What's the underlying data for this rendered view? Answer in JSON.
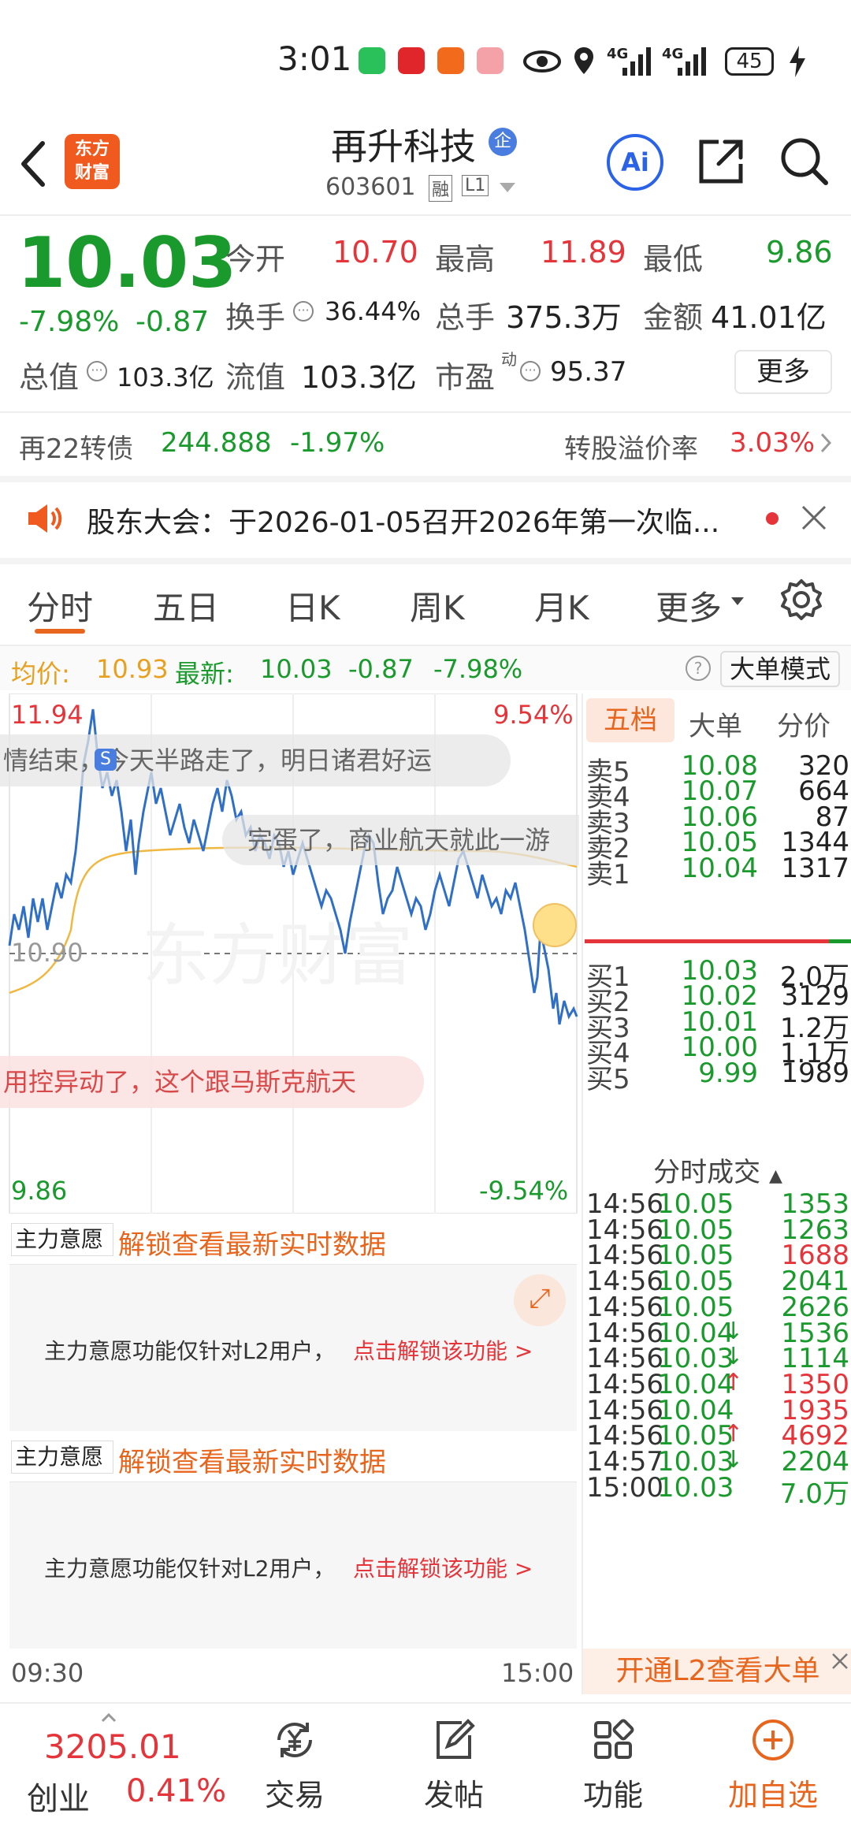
{
  "status_bar": {
    "time": "3:01",
    "battery": "45",
    "signal1": "4G",
    "signal2": "4G"
  },
  "header": {
    "logo_line1": "东方",
    "logo_line2": "财富",
    "stock_name": "再升科技",
    "enterprise_badge": "企",
    "stock_code": "603601",
    "tag_margin": "融",
    "tag_level": "L1",
    "ai_label": "Ai"
  },
  "quote": {
    "price": "10.03",
    "change_pct": "-7.98%",
    "change": "-0.87",
    "open_label": "今开",
    "open": "10.70",
    "high_label": "最高",
    "high": "11.89",
    "low_label": "最低",
    "low": "9.86",
    "turnover_label": "换手",
    "turnover": "36.44%",
    "volume_label": "总手",
    "volume": "375.3万",
    "amount_label": "金额",
    "amount": "41.01亿",
    "mcap_label": "总值",
    "mcap": "103.3亿",
    "float_label": "流值",
    "float_cap": "103.3亿",
    "pe_label": "市盈",
    "pe_sup": "动",
    "pe": "95.37",
    "more": "更多"
  },
  "bond": {
    "name": "再22转债",
    "price": "244.888",
    "change": "-1.97%",
    "premium_label": "转股溢价率",
    "premium": "3.03%"
  },
  "notice": {
    "text": "股东大会：于2026-01-05召开2026年第一次临..."
  },
  "tabs": [
    "分时",
    "五日",
    "日K",
    "周K",
    "月K",
    "更多"
  ],
  "avg_bar": {
    "avg_label": "均价:",
    "avg": "10.93",
    "latest_label": "最新:",
    "latest": "10.03",
    "chg": "-0.87",
    "pct": "-7.98%",
    "mode": "大单模式"
  },
  "chart": {
    "high_price": "11.94",
    "high_pct": "9.54%",
    "low_price": "9.86",
    "low_pct": "-9.54%",
    "mid_price": "10.90",
    "start_time": "09:30",
    "end_time": "15:00",
    "watermark": "东方财富",
    "comment1": "情结束，今天半路走了，明日诸君好运",
    "comment2": "完蛋了，商业航天就此一游",
    "comment3": "用控异动了，这个跟马斯克航天"
  },
  "order_book": {
    "tabs": [
      "五档",
      "大单",
      "分价"
    ],
    "asks": [
      {
        "label": "卖5",
        "price": "10.08",
        "vol": "320"
      },
      {
        "label": "卖4",
        "price": "10.07",
        "vol": "664"
      },
      {
        "label": "卖3",
        "price": "10.06",
        "vol": "87"
      },
      {
        "label": "卖2",
        "price": "10.05",
        "vol": "1344"
      },
      {
        "label": "卖1",
        "price": "10.04",
        "vol": "1317"
      }
    ],
    "bids": [
      {
        "label": "买1",
        "price": "10.03",
        "vol": "2.0万"
      },
      {
        "label": "买2",
        "price": "10.02",
        "vol": "3129"
      },
      {
        "label": "买3",
        "price": "10.01",
        "vol": "1.2万"
      },
      {
        "label": "买4",
        "price": "10.00",
        "vol": "1.1万"
      },
      {
        "label": "买5",
        "price": "9.99",
        "vol": "1989"
      }
    ],
    "trades_title": "分时成交",
    "trades": [
      {
        "t": "14:56",
        "p": "10.05",
        "a": "",
        "v": "1353",
        "c": "green"
      },
      {
        "t": "14:56",
        "p": "10.05",
        "a": "",
        "v": "1263",
        "c": "green"
      },
      {
        "t": "14:56",
        "p": "10.05",
        "a": "",
        "v": "1688",
        "c": "red"
      },
      {
        "t": "14:56",
        "p": "10.05",
        "a": "",
        "v": "2041",
        "c": "green"
      },
      {
        "t": "14:56",
        "p": "10.05",
        "a": "",
        "v": "2626",
        "c": "green"
      },
      {
        "t": "14:56",
        "p": "10.04",
        "a": "↓",
        "v": "1536",
        "c": "green"
      },
      {
        "t": "14:56",
        "p": "10.03",
        "a": "↓",
        "v": "1114",
        "c": "green"
      },
      {
        "t": "14:56",
        "p": "10.04",
        "a": "↑",
        "v": "1350",
        "c": "red"
      },
      {
        "t": "14:56",
        "p": "10.04",
        "a": "",
        "v": "1935",
        "c": "red"
      },
      {
        "t": "14:56",
        "p": "10.05",
        "a": "↑",
        "v": "4692",
        "c": "red"
      },
      {
        "t": "14:57",
        "p": "10.03",
        "a": "↓",
        "v": "2204",
        "c": "green"
      },
      {
        "t": "15:00",
        "p": "10.03",
        "a": "",
        "v": "7.0万",
        "c": "green"
      }
    ],
    "l2_banner": "开通L2查看大单"
  },
  "panels": [
    {
      "select": "主力意愿",
      "unlock": "解锁查看最新实时数据",
      "msg": "主力意愿功能仅针对L2用户，",
      "link": "点击解锁该功能 >"
    },
    {
      "select": "主力意愿",
      "unlock": "解锁查看最新实时数据",
      "msg": "主力意愿功能仅针对L2用户，",
      "link": "点击解锁该功能 >"
    }
  ],
  "footer": {
    "index_value": "3205.01",
    "index_name": "创业",
    "index_pct": "0.41%",
    "trade": "交易",
    "post": "发帖",
    "function": "功能",
    "add": "加自选"
  },
  "colors": {
    "up": "#e5353a",
    "down": "#1a9a2c",
    "accent": "#e8651d",
    "price_line": "#2f6fc7",
    "avg_line": "#f0b840"
  }
}
